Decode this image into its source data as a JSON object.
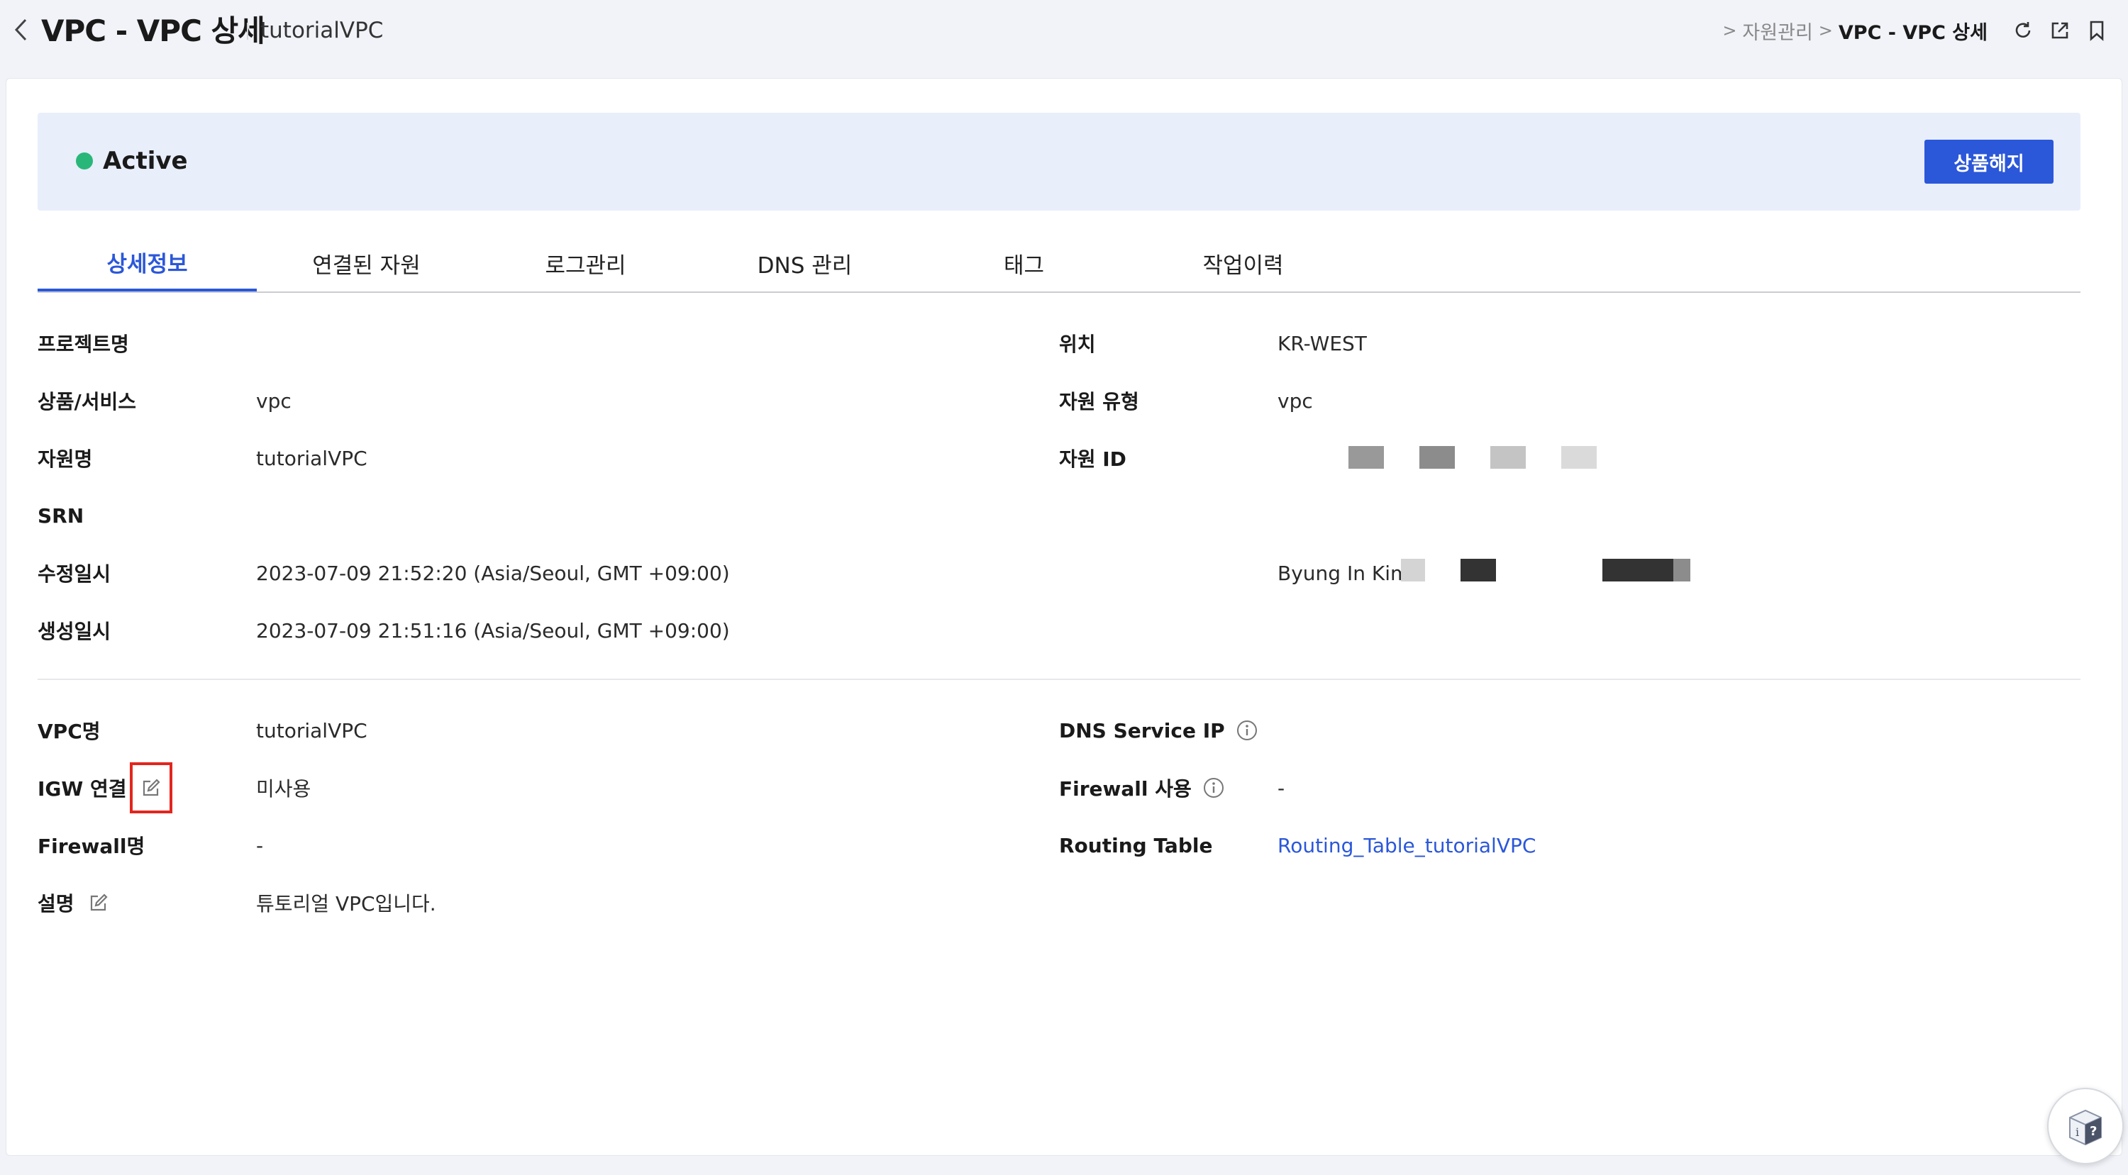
{
  "header": {
    "title": "VPC - VPC 상세",
    "subtitle": "tutorialVPC",
    "breadcrumb": [
      "자원관리",
      "VPC - VPC 상세"
    ]
  },
  "status": {
    "label": "Active",
    "color": "#29b779",
    "terminate_label": "상품해지"
  },
  "tabs": [
    {
      "label": "상세정보",
      "active": true
    },
    {
      "label": "연결된 자원",
      "active": false
    },
    {
      "label": "로그관리",
      "active": false
    },
    {
      "label": "DNS 관리",
      "active": false
    },
    {
      "label": "태그",
      "active": false
    },
    {
      "label": "작업이력",
      "active": false
    }
  ],
  "details": {
    "project_name_label": "프로젝트명",
    "project_name_value": "",
    "product_label": "상품/서비스",
    "product_value": "vpc",
    "resource_name_label": "자원명",
    "resource_name_value": "tutorialVPC",
    "srn_label": "SRN",
    "srn_value": "",
    "modified_label": "수정일시",
    "modified_value": "2023-07-09 21:52:20 (Asia/Seoul, GMT +09:00)",
    "created_label": "생성일시",
    "created_value": "2023-07-09 21:51:16 (Asia/Seoul, GMT +09:00)",
    "location_label": "위치",
    "location_value": "KR-WEST",
    "resource_type_label": "자원 유형",
    "resource_type_value": "vpc",
    "resource_id_label": "자원 ID",
    "modifier_value": "Byung In Kim"
  },
  "vpc": {
    "vpc_name_label": "VPC명",
    "vpc_name_value": "tutorialVPC",
    "igw_label": "IGW 연결",
    "igw_value": "미사용",
    "firewall_name_label": "Firewall명",
    "firewall_name_value": "-",
    "description_label": "설명",
    "description_value": "튜토리얼 VPC입니다.",
    "dns_service_ip_label": "DNS Service IP",
    "firewall_use_label": "Firewall 사용",
    "firewall_use_value": "-",
    "routing_table_label": "Routing Table",
    "routing_table_value": "Routing_Table_tutorialVPC"
  },
  "colors": {
    "accent": "#2b57d9",
    "highlight_box": "#e2261e",
    "status_bg": "#e8eefa"
  },
  "icons": {
    "back": "chevron-left-icon",
    "refresh": "refresh-icon",
    "external": "external-link-icon",
    "bookmark": "bookmark-icon",
    "info": "info-circle-icon",
    "edit": "edit-icon",
    "help": "help-icon"
  }
}
